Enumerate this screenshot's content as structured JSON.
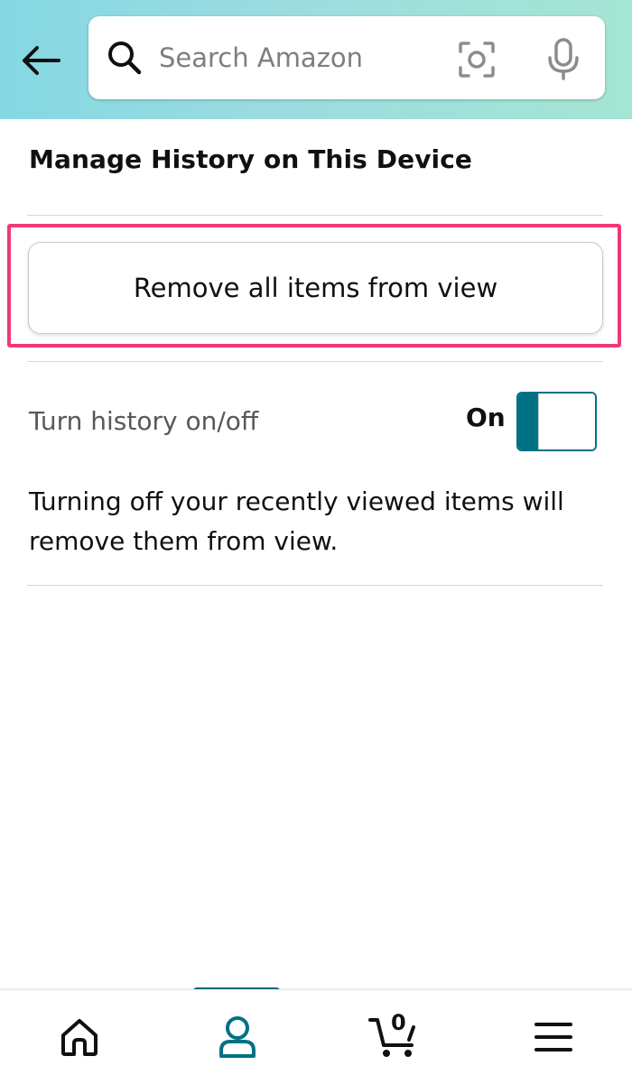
{
  "header": {
    "search_placeholder": "Search Amazon",
    "background_gradient": [
      "#84d8e3",
      "#a5e5d3"
    ],
    "icons": [
      "back-arrow-icon",
      "search-icon",
      "camera-icon",
      "microphone-icon"
    ]
  },
  "main": {
    "title": "Manage History on This Device",
    "remove_button_label": "Remove all items from view",
    "highlight_color": "#f0387a",
    "toggle": {
      "label": "Turn history on/off",
      "state_label": "On",
      "is_on": true,
      "accent_color": "#007185"
    },
    "description": "Turning off your recently viewed items will remove them from view."
  },
  "bottom_nav": {
    "items": [
      "home-icon",
      "account-icon",
      "cart-icon",
      "menu-icon"
    ],
    "active_index": 1,
    "cart_count": "0"
  }
}
